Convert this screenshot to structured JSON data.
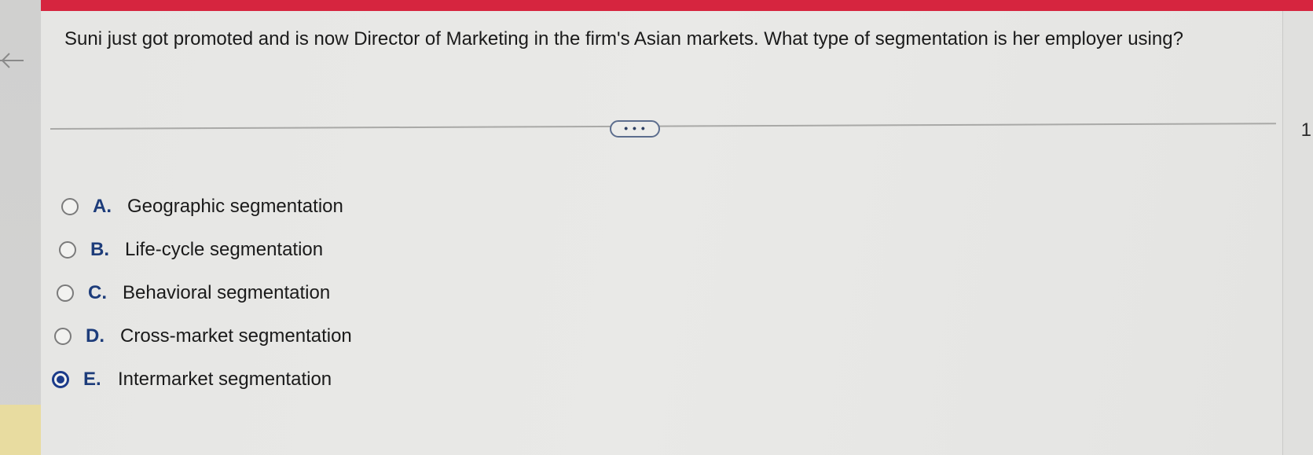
{
  "question": {
    "text": "Suni just got promoted and is now Director of Marketing in the firm's Asian markets. What type of segmentation is her employer using?"
  },
  "more_button": {
    "label": "• • •"
  },
  "options": [
    {
      "letter": "A.",
      "text": "Geographic segmentation",
      "selected": false
    },
    {
      "letter": "B.",
      "text": "Life-cycle segmentation",
      "selected": false
    },
    {
      "letter": "C.",
      "text": "Behavioral segmentation",
      "selected": false
    },
    {
      "letter": "D.",
      "text": "Cross-market segmentation",
      "selected": false
    },
    {
      "letter": "E.",
      "text": "Intermarket segmentation",
      "selected": true
    }
  ],
  "right_edge": {
    "number": "1"
  },
  "colors": {
    "top_bar": "#d6253f",
    "letter": "#1d3c7a",
    "selected_radio": "#1b3b8a"
  }
}
